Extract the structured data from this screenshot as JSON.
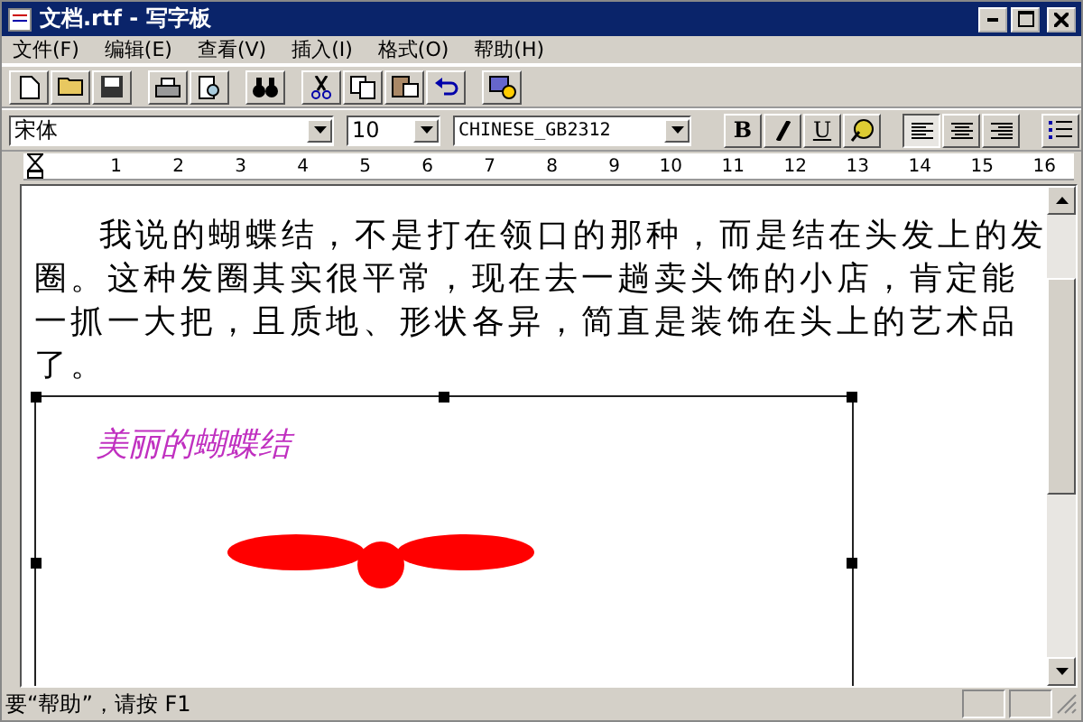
{
  "window": {
    "title": "文档.rtf - 写字板"
  },
  "menu": [
    "文件(F)",
    "编辑(E)",
    "查看(V)",
    "插入(I)",
    "格式(O)",
    "帮助(H)"
  ],
  "format_bar": {
    "font": "宋体",
    "size": "10",
    "script": "CHINESE_GB2312",
    "bold_label": "B",
    "underline_label": "U",
    "alignment": [
      {
        "kind": "left",
        "selected": true
      },
      {
        "kind": "center",
        "selected": false
      },
      {
        "kind": "right",
        "selected": false
      }
    ]
  },
  "ruler": {
    "marks": [
      "1",
      "2",
      "3",
      "4",
      "5",
      "6",
      "7",
      "8",
      "9",
      "10",
      "11",
      "12",
      "13",
      "14",
      "15",
      "16"
    ]
  },
  "document": {
    "paragraph": "我说的蝴蝶结，不是打在领口的那种，而是结在头发上的发圈。这种发圈其实很平常，现在去一趟卖头饰的小店，肯定能一抓一大把，且质地、形状各异，简直是装饰在头上的艺术品了。",
    "object": {
      "caption": "美丽的蝴蝶结"
    }
  },
  "status_bar": "要“帮助”，请按 F1"
}
